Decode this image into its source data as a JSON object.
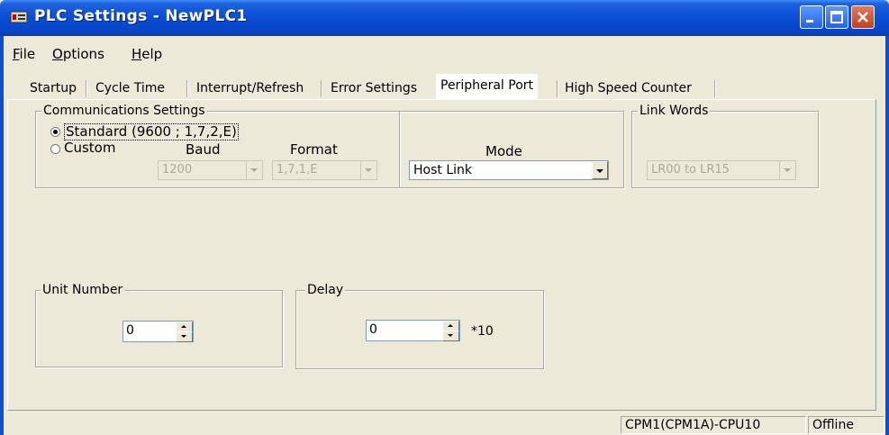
{
  "window": {
    "title": "PLC Settings - NewPLC1"
  },
  "menu": [
    {
      "label": "File",
      "u": "F",
      "rest": "ile"
    },
    {
      "label": "Options",
      "u": "O",
      "rest": "ptions"
    },
    {
      "label": "Help",
      "u": "H",
      "rest": "elp"
    }
  ],
  "tabs": [
    {
      "label": "Startup"
    },
    {
      "label": "Cycle Time"
    },
    {
      "label": "Interrupt/Refresh"
    },
    {
      "label": "Error Settings"
    },
    {
      "label": "Peripheral Port",
      "active": true
    },
    {
      "label": "High Speed Counter"
    }
  ],
  "comm": {
    "legend": "Communications Settings",
    "standard_label": "Standard (9600 ; 1,7,2,E)",
    "custom_label": "Custom",
    "baud_label": "Baud",
    "format_label": "Format",
    "baud_value": "1200",
    "format_value": "1,7,1,E",
    "mode_label": "Mode",
    "mode_value": "Host Link"
  },
  "link_words": {
    "legend": "Link Words",
    "value": "LR00 to LR15"
  },
  "unit_number": {
    "legend": "Unit Number",
    "value": "0"
  },
  "delay": {
    "legend": "Delay",
    "value": "0",
    "unit": "*10"
  },
  "status": {
    "model": "CPM1(CPM1A)-CPU10",
    "connection": "Offline"
  },
  "colors": {
    "titlebar": "#0a4fd6",
    "face": "#ece9d8",
    "close": "#c1401c"
  }
}
